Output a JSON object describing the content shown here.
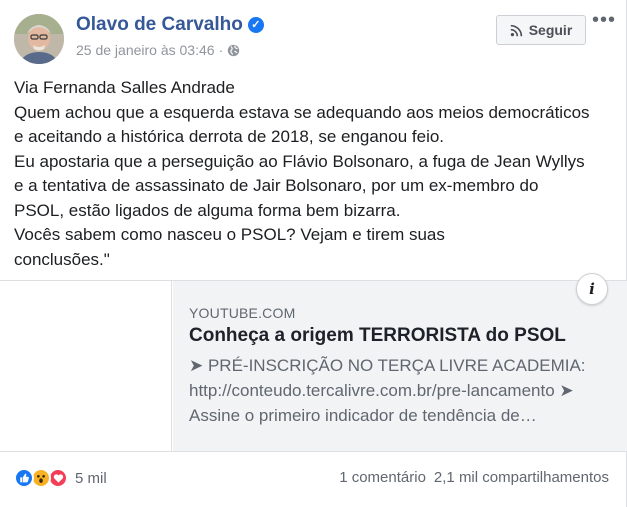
{
  "post": {
    "author": "Olavo de Carvalho",
    "timestamp": "25 de janeiro às 03:46",
    "privacy_icon": "globe-icon",
    "follow_label": "Seguir",
    "more_icon": "•••",
    "text_lines": [
      "Via Fernanda Salles Andrade",
      "Quem achou que a esquerda estava se adequando aos meios democráticos",
      "e aceitando a histórica derrota de 2018, se enganou feio.",
      "Eu apostaria que a perseguição ao Flávio Bolsonaro, a fuga de Jean Wyllys",
      "e a tentativa de assassinato de Jair Bolsonaro, por um ex-membro do",
      "PSOL, estão ligados de alguma forma bem bizarra.",
      "Vocês sabem como nasceu o PSOL? Vejam e tirem suas",
      "conclusões.\""
    ]
  },
  "link_preview": {
    "domain": "YOUTUBE.COM",
    "title": "Conheça a origem TERRORISTA do PSOL",
    "description_lines": [
      "➤ PRÉ-INSCRIÇÃO NO TERÇA LIVRE ACADEMIA:",
      "http://conteudo.tercalivre.com.br/pre-lancamento ➤",
      "Assine o primeiro indicador de tendência de…"
    ],
    "info_label": "i"
  },
  "footer": {
    "reaction_icons": [
      "like-icon",
      "wow-icon",
      "love-icon"
    ],
    "reaction_count": "5 mil",
    "comments": "1 comentário",
    "shares": "2,1 mil compartilhamentos"
  },
  "colors": {
    "author_link": "#365899",
    "verified": "#1877f2",
    "like": "#1877f2",
    "wow": "#f7b125",
    "love": "#f33e58"
  }
}
